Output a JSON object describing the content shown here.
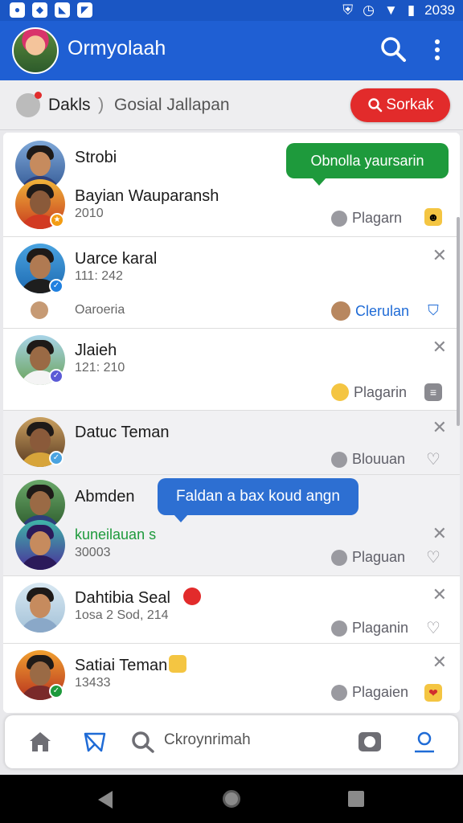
{
  "status_bar": {
    "time": "2039"
  },
  "app_bar": {
    "title": "Ormyolaah"
  },
  "breadcrumb": {
    "first": "Dakls",
    "separator": ")",
    "second": "Gosial Jallapan"
  },
  "search_button": {
    "label": "Sorkak"
  },
  "contacts": [
    {
      "name": "Strobi",
      "extra_name": "Bayian Wauparansh",
      "sub": "2010",
      "meta": "Plagarn",
      "bubble": "Obnolla yaursarin"
    },
    {
      "name": "Uarce karal",
      "sub": "111: 242",
      "note": "Oaroeria",
      "meta": "Clerulan"
    },
    {
      "name": "Jlaieh",
      "sub": "121: 210",
      "meta": "Plagarin"
    },
    {
      "name": "Datuc Teman",
      "meta": "Blouuan"
    },
    {
      "name": "Abmden",
      "extra_name": "kuneilauan s",
      "sub": "30003",
      "meta": "Plaguan",
      "bubble": "Faldan a bax koud angn"
    },
    {
      "name": "Dahtibia Seal",
      "sub": "1osa 2 Sod, 214",
      "meta": "Plaganin"
    },
    {
      "name": "Satiai Teman",
      "sub": "13433",
      "meta": "Plagaien"
    }
  ],
  "bottom_nav": {
    "label": "Ckroynrimah"
  },
  "colors": {
    "primary": "#1f5fd3",
    "danger": "#e22b2b",
    "green": "#1e9a3c"
  }
}
